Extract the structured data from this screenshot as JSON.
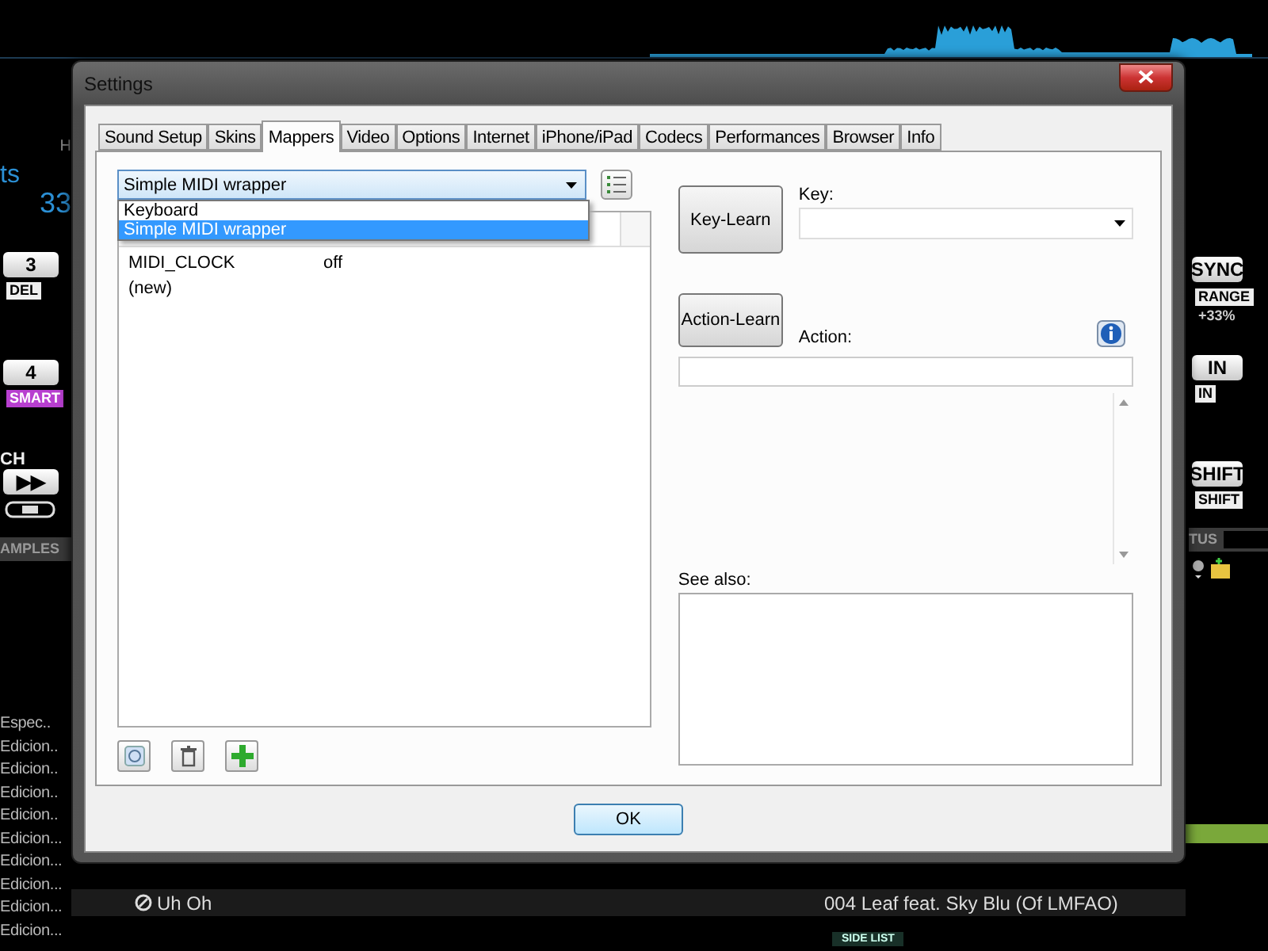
{
  "deck_left": {
    "hotcue_header": "H",
    "counter": "ts",
    "bpm": "33",
    "pads": [
      {
        "key": "3",
        "label": "DEL",
        "kind": "plain"
      },
      {
        "key": "4",
        "label": "SMART",
        "kind": "accent"
      }
    ],
    "transport_label": "CH",
    "play_key": "▶▶"
  },
  "samples_header": "AMPLES",
  "folders": [
    "Espec..",
    "Edicion..",
    "Edicion..",
    "Edicion..",
    "Edicion..",
    "Edicion...",
    "Edicion...",
    "Edicion...",
    "Edicion...",
    "Edicion..."
  ],
  "deck_right": {
    "sync": "SYNC",
    "range": "RANGE",
    "pitch": "+33%",
    "in_key": "IN",
    "in_label": "IN",
    "shift_key": "SHIFT",
    "shift_label": "SHIFT",
    "status": "TUS",
    "level": 1
  },
  "tracks": [
    {
      "title": "Uh Oh",
      "artist": "004 Leaf feat. Sky Blu (Of LMFAO)"
    }
  ],
  "side_list": "SIDE LIST",
  "dialog": {
    "title": "Settings",
    "tabs": [
      {
        "label": "Sound Setup",
        "selected": false
      },
      {
        "label": "Skins",
        "selected": false
      },
      {
        "label": "Mappers",
        "selected": true
      },
      {
        "label": "Video",
        "selected": false
      },
      {
        "label": "Options",
        "selected": false
      },
      {
        "label": "Internet",
        "selected": false
      },
      {
        "label": "iPhone/iPad",
        "selected": false
      },
      {
        "label": "Codecs",
        "selected": false
      },
      {
        "label": "Performances",
        "selected": false
      },
      {
        "label": "Browser",
        "selected": false
      },
      {
        "label": "Info",
        "selected": false
      }
    ],
    "mapper": {
      "value": "Simple MIDI wrapper",
      "options": [
        {
          "label": "Keyboard",
          "selected": false
        },
        {
          "label": "Simple MIDI wrapper",
          "selected": true
        }
      ]
    },
    "mappings": [
      {
        "key": "MIDI_CLOCK",
        "action": "off"
      },
      {
        "key": "(new)"
      }
    ],
    "key_learn": "Key-Learn",
    "key_label": "Key:",
    "action_learn": "Action-Learn",
    "action_label": "Action:",
    "see_also_label": "See also:",
    "ok": "OK"
  }
}
